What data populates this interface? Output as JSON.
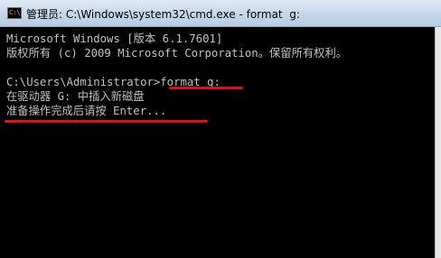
{
  "window": {
    "title": "管理员: C:\\Windows\\system32\\cmd.exe - format  g:",
    "icon": "cmd-icon",
    "icon_text": "C:\\"
  },
  "console": {
    "lines": [
      "Microsoft Windows [版本 6.1.7601]",
      "版权所有 (c) 2009 Microsoft Corporation。保留所有权利。",
      "",
      "C:\\Users\\Administrator>format g:",
      "在驱动器 G: 中插入新磁盘",
      "准备操作完成后请按 Enter..."
    ]
  },
  "annotations": {
    "underline_color": "#e0101a"
  }
}
